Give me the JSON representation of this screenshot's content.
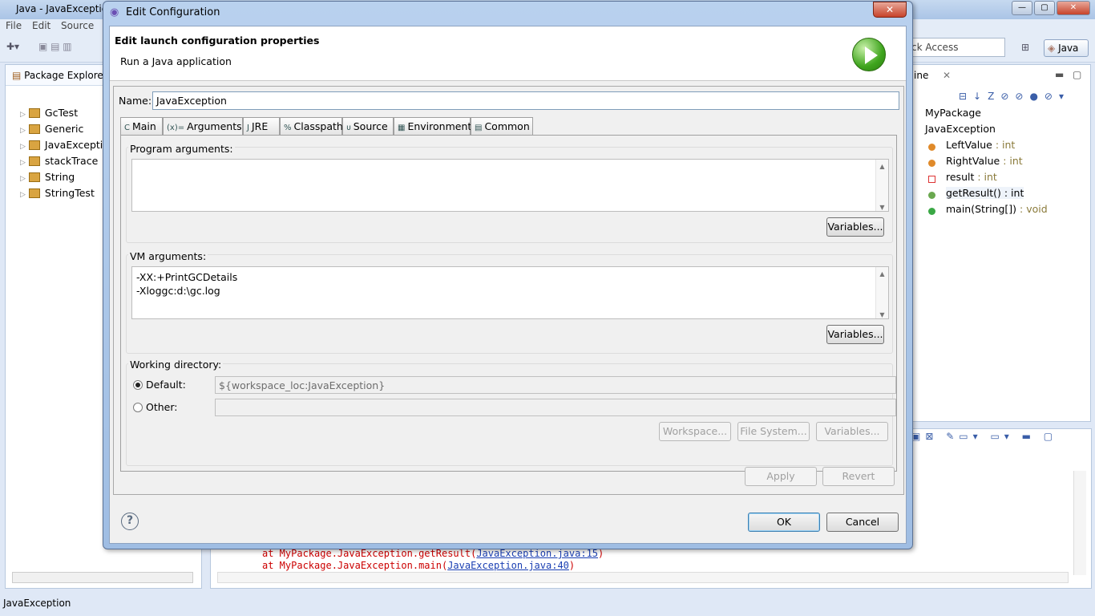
{
  "window": {
    "title": "Java - JavaExceptic",
    "menu": [
      "File",
      "Edit",
      "Source"
    ]
  },
  "toolbar": {
    "quick_access": "ck Access",
    "perspective": "Java"
  },
  "package_explorer": {
    "title": "Package Explorer",
    "items": [
      "GcTest",
      "Generic",
      "JavaExceptic",
      "stackTrace",
      "String",
      "StringTest"
    ]
  },
  "outline": {
    "tab": "ine",
    "items": [
      {
        "name": "MyPackage",
        "type": ""
      },
      {
        "name": "JavaException",
        "type": ""
      },
      {
        "name": "LeftValue",
        "type": " : int"
      },
      {
        "name": "RightValue",
        "type": " : int"
      },
      {
        "name": "result",
        "type": " : int"
      },
      {
        "name": "getResult() : int",
        "type": ""
      },
      {
        "name": "main(String[])",
        "type": " : void"
      }
    ]
  },
  "console": {
    "lines": [
      {
        "prefix": "at MyPackage.JavaException.getResult(",
        "link": "JavaException.java:15",
        "suffix": ")"
      },
      {
        "prefix": "at MyPackage.JavaException.main(",
        "link": "JavaException.java:40",
        "suffix": ")"
      }
    ]
  },
  "status": {
    "text": "JavaException"
  },
  "dialog": {
    "title": "Edit Configuration",
    "banner_title": "Edit launch configuration properties",
    "banner_subtitle": "Run a Java application",
    "name_label": "Name:",
    "name_value": "JavaException",
    "tabs": [
      "Main",
      "Arguments",
      "JRE",
      "Classpath",
      "Source",
      "Environment",
      "Common"
    ],
    "tab_icons": [
      "C",
      "(x)=",
      "J",
      "%",
      "ᴜ",
      "▦",
      "▤"
    ],
    "active_tab": "Arguments",
    "program_args_label": "Program arguments:",
    "program_args": "",
    "variables_label": "Variables...",
    "vm_args_label": "VM arguments:",
    "vm_args": "-XX:+PrintGCDetails\n-Xloggc:d:\\gc.log",
    "workdir_label": "Working directory:",
    "default_label": "Default:",
    "default_value": "${workspace_loc:JavaException}",
    "other_label": "Other:",
    "other_value": "",
    "workspace_btn": "Workspace...",
    "filesystem_btn": "File System...",
    "apply": "Apply",
    "revert": "Revert",
    "ok": "OK",
    "cancel": "Cancel"
  }
}
